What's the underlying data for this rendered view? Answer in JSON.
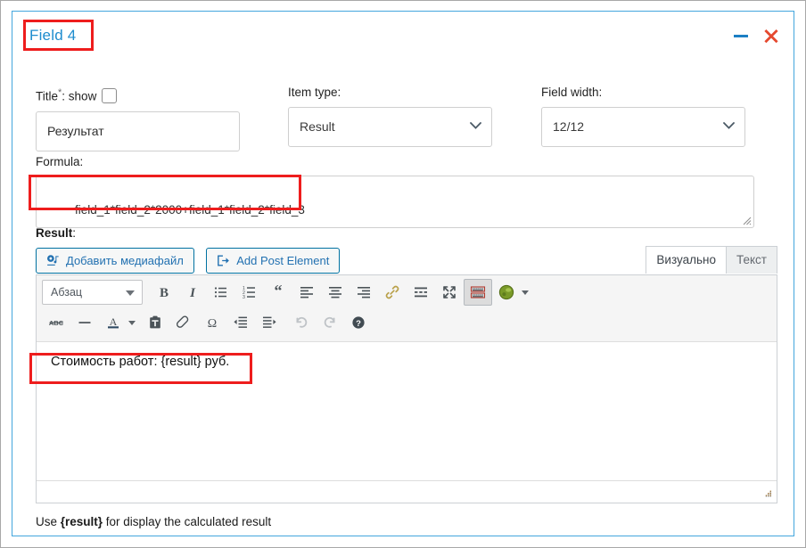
{
  "panel": {
    "title": "Field 4",
    "minimize_icon": "minus-icon",
    "close_icon": "close-x-icon"
  },
  "fields": {
    "title": {
      "label": "Title",
      "required_mark": "*",
      "show_label": ": show",
      "value": "Результат"
    },
    "item_type": {
      "label": "Item type:",
      "value": "Result"
    },
    "field_width": {
      "label": "Field width:",
      "value": "12/12"
    }
  },
  "formula": {
    "label": "Formula:",
    "value": "field_1*field_2*2000+field_1*field_2*field_3"
  },
  "result": {
    "label": "Result",
    "label_colon": ":",
    "media_buttons": [
      {
        "name": "add-media-button",
        "label": "Добавить медиафайл",
        "icon": "media-icon"
      },
      {
        "name": "add-post-element-button",
        "label": "Add Post Element",
        "icon": "post-element-icon"
      }
    ],
    "tabs": [
      {
        "label": "Визуально",
        "active": true
      },
      {
        "label": "Текст",
        "active": false
      }
    ],
    "editor": {
      "format_select": "Абзац",
      "toolbar_row1": [
        "bold-icon",
        "italic-icon",
        "bulleted-list-icon",
        "numbered-list-icon",
        "blockquote-icon",
        "align-left-icon",
        "align-center-icon",
        "align-right-icon",
        "link-icon",
        "read-more-icon",
        "fullscreen-icon",
        "toolbar-toggle-icon",
        "plugin-green-icon",
        "plugin-dropdown-arrow-icon"
      ],
      "toolbar_row2": [
        "strikethrough-icon",
        "horizontal-rule-icon",
        "text-color-icon",
        "text-color-dropdown-arrow-icon",
        "paste-as-text-icon",
        "clear-formatting-icon",
        "special-character-icon",
        "decrease-indent-icon",
        "increase-indent-icon",
        "undo-icon",
        "redo-icon",
        "keyboard-shortcuts-help-icon"
      ],
      "content": "Стоимость работ: {result} руб."
    }
  },
  "hint": {
    "prefix": "Use ",
    "token": "{result}",
    "suffix": " for display the calculated result"
  },
  "colors": {
    "panel_border": "#43a6dd",
    "title_text": "#1e8cce",
    "annotation": "#ee1d1d",
    "minimize": "#1c7fc4",
    "close": "#e5492f",
    "button_text": "#2271b1",
    "plugin_icon": "#7a9a28"
  }
}
